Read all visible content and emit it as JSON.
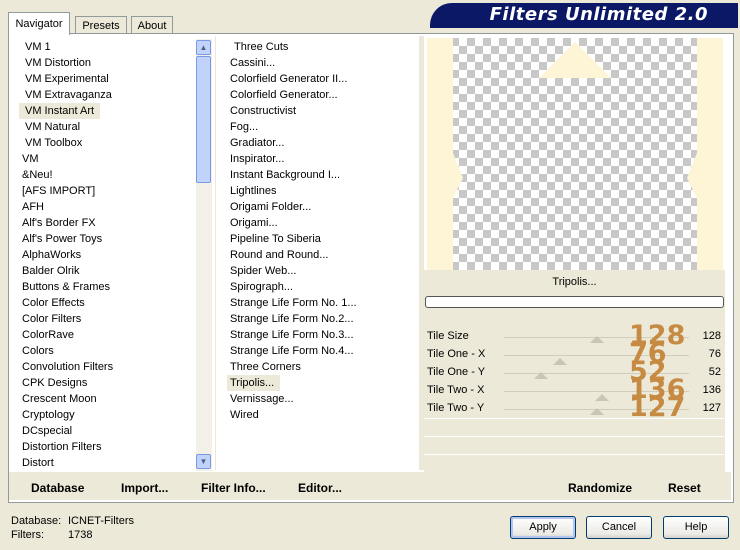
{
  "tabs": [
    {
      "label": "Navigator",
      "active": true
    },
    {
      "label": "Presets",
      "active": false
    },
    {
      "label": "About",
      "active": false
    }
  ],
  "banner": {
    "title": "Filters Unlimited 2.0"
  },
  "categories": {
    "items": [
      "VM 1",
      "VM Distortion",
      "VM Experimental",
      "VM Extravaganza",
      "VM Instant Art",
      "VM Natural",
      "VM Toolbox",
      "VM",
      "&Neu!",
      "[AFS IMPORT]",
      "AFH",
      "Alf's Border FX",
      "Alf's Power Toys",
      "AlphaWorks",
      "Balder Olrik",
      "Buttons & Frames",
      "Color Effects",
      "Color Filters",
      "ColorRave",
      "Colors",
      "Convolution Filters",
      "CPK Designs",
      "Crescent Moon",
      "Cryptology",
      "DCspecial",
      "Distortion Filters",
      "Distort"
    ],
    "selected_index": 4
  },
  "filters": {
    "items": [
      "Three Cuts",
      "Cassini...",
      "Colorfield Generator II...",
      "Colorfield Generator...",
      "Constructivist",
      "Fog...",
      "Gradiator...",
      "Inspirator...",
      "Instant Background I...",
      "Lightlines",
      "Origami Folder...",
      "Origami...",
      "Pipeline To Siberia",
      "Round and Round...",
      "Spider Web...",
      "Spirograph...",
      "Strange Life Form No. 1...",
      "Strange Life Form No.2...",
      "Strange Life Form No.3...",
      "Strange Life Form No.4...",
      "Three Corners",
      "Tripolis...",
      "Vernissage...",
      "Wired"
    ],
    "selected_index": 21
  },
  "preview": {
    "filter_name": "Tripolis...",
    "accent_color": "#fdf5d6"
  },
  "params": [
    {
      "label": "Tile Size",
      "value": "128",
      "big": "128",
      "level": 0.5
    },
    {
      "label": "Tile One - X",
      "value": "76",
      "big": "76",
      "level": 0.3
    },
    {
      "label": "Tile One - Y",
      "value": "52",
      "big": "52",
      "level": 0.2
    },
    {
      "label": "Tile Two - X",
      "value": "136",
      "big": "136",
      "level": 0.53
    },
    {
      "label": "Tile Two - Y",
      "value": "127",
      "big": "127",
      "level": 0.5
    }
  ],
  "bottom_buttons": {
    "database": "Database",
    "import": "Import...",
    "filter_info": "Filter Info...",
    "editor": "Editor...",
    "randomize": "Randomize",
    "reset": "Reset"
  },
  "status": {
    "database_label": "Database:",
    "database_value": "ICNET-Filters",
    "filters_label": "Filters:",
    "filters_value": "1738"
  },
  "dialog_buttons": {
    "apply": "Apply",
    "cancel": "Cancel",
    "help": "Help"
  },
  "colors": {
    "accent_number": "#c68a43",
    "banner": "#0a1866",
    "panel": "#ece9d8"
  }
}
